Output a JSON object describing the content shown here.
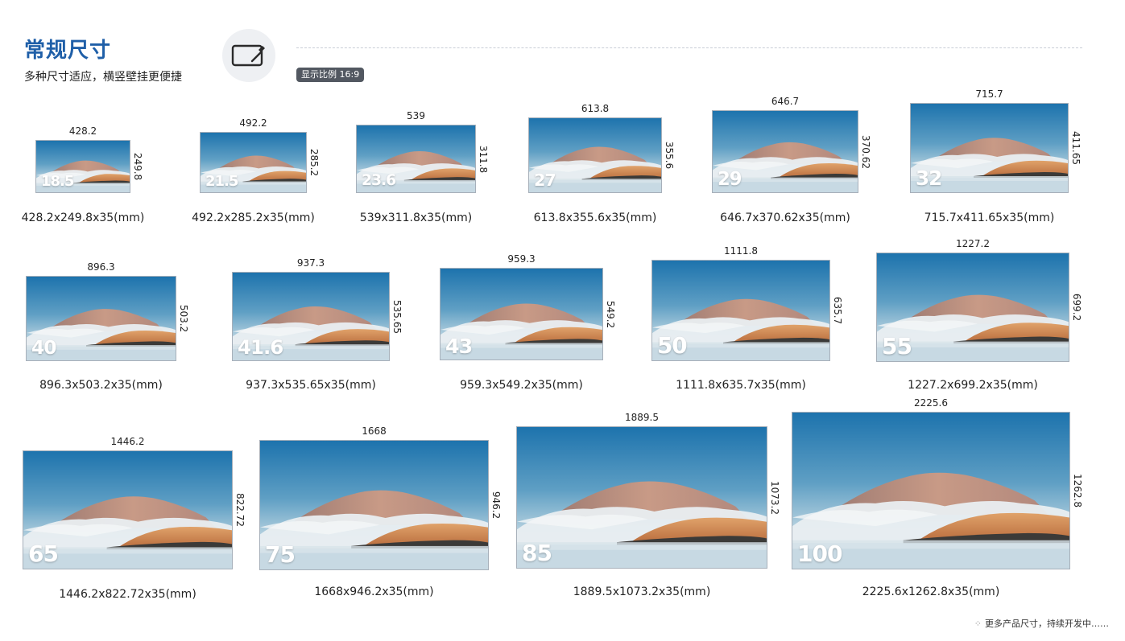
{
  "header": {
    "title": "常规尺寸",
    "subtitle": "多种尺寸适应，横竖壁挂更便捷",
    "ratio_badge": "显示比例 16:9",
    "icon": "tablet-pen-icon"
  },
  "footer": {
    "note": "更多产品尺寸，持续开发中……",
    "icon": "sparkle-icon"
  },
  "screens": [
    {
      "size": "18.5",
      "width": "428.2",
      "height": "249.8",
      "caption": "428.2x249.8x35(mm)"
    },
    {
      "size": "21.5",
      "width": "492.2",
      "height": "285.2",
      "caption": "492.2x285.2x35(mm)"
    },
    {
      "size": "23.6",
      "width": "539",
      "height": "311.8",
      "caption": "539x311.8x35(mm)"
    },
    {
      "size": "27",
      "width": "613.8",
      "height": "355.6",
      "caption": "613.8x355.6x35(mm)"
    },
    {
      "size": "29",
      "width": "646.7",
      "height": "370.62",
      "caption": "646.7x370.62x35(mm)"
    },
    {
      "size": "32",
      "width": "715.7",
      "height": "411.65",
      "caption": "715.7x411.65x35(mm)"
    },
    {
      "size": "40",
      "width": "896.3",
      "height": "503.2",
      "caption": "896.3x503.2x35(mm)"
    },
    {
      "size": "41.6",
      "width": "937.3",
      "height": "535.65",
      "caption": "937.3x535.65x35(mm)"
    },
    {
      "size": "43",
      "width": "959.3",
      "height": "549.2",
      "caption": "959.3x549.2x35(mm)"
    },
    {
      "size": "50",
      "width": "1111.8",
      "height": "635.7",
      "caption": "1111.8x635.7x35(mm)"
    },
    {
      "size": "55",
      "width": "1227.2",
      "height": "699.2",
      "caption": "1227.2x699.2x35(mm)"
    },
    {
      "size": "65",
      "width": "1446.2",
      "height": "822.72",
      "caption": "1446.2x822.72x35(mm)"
    },
    {
      "size": "75",
      "width": "1668",
      "height": "946.2",
      "caption": "1668x946.2x35(mm)"
    },
    {
      "size": "85",
      "width": "1889.5",
      "height": "1073.2",
      "caption": "1889.5x1073.2x35(mm)"
    },
    {
      "size": "100",
      "width": "2225.6",
      "height": "1262.8",
      "caption": "2225.6x1262.8x35(mm)"
    }
  ]
}
